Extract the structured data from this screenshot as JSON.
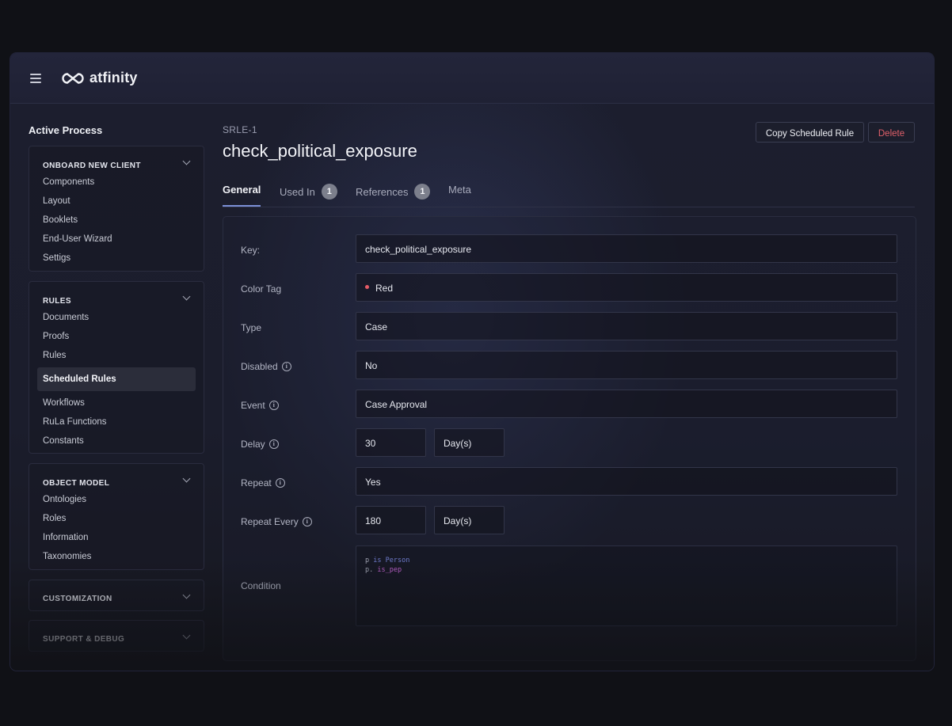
{
  "app": {
    "brand": "atfinity"
  },
  "sidebar": {
    "title": "Active Process",
    "groups": [
      {
        "label": "ONBOARD NEW CLIENT",
        "items": [
          "Components",
          "Layout",
          "Booklets",
          "End-User Wizard",
          "Settigs"
        ]
      },
      {
        "label": "RULES",
        "items": [
          "Documents",
          "Proofs",
          "Rules",
          "Scheduled Rules",
          "Workflows",
          "RuLa Functions",
          "Constants"
        ],
        "active": "Scheduled Rules"
      },
      {
        "label": "OBJECT MODEL",
        "items": [
          "Ontologies",
          "Roles",
          "Information",
          "Taxonomies"
        ]
      },
      {
        "label": "CUSTOMIZATION",
        "items": []
      },
      {
        "label": "SUPPORT & DEBUG",
        "items": []
      }
    ]
  },
  "header": {
    "id": "SRLE-1",
    "title": "check_political_exposure",
    "copy_label": "Copy Scheduled Rule",
    "delete_label": "Delete"
  },
  "tabs": [
    {
      "label": "General",
      "active": true
    },
    {
      "label": "Used In",
      "badge": "1"
    },
    {
      "label": "References",
      "badge": "1"
    },
    {
      "label": "Meta"
    }
  ],
  "form": {
    "key": {
      "label": "Key:",
      "value": "check_political_exposure"
    },
    "color_tag": {
      "label": "Color Tag",
      "value": "Red",
      "color": "#e55b66"
    },
    "type": {
      "label": "Type",
      "value": "Case"
    },
    "disabled": {
      "label": "Disabled",
      "value": "No"
    },
    "event": {
      "label": "Event",
      "value": "Case Approval"
    },
    "delay": {
      "label": "Delay",
      "value": "30",
      "unit": "Day(s)"
    },
    "repeat": {
      "label": "Repeat",
      "value": "Yes"
    },
    "repeat_every": {
      "label": "Repeat Every",
      "value": "180",
      "unit": "Day(s)"
    },
    "condition": {
      "label": "Condition",
      "line1": {
        "var": "p",
        "op": "is Person"
      },
      "line2": {
        "var": "p.",
        "op": "is_pep"
      }
    }
  },
  "colors": {
    "accent": "#7b8fd6",
    "danger": "#e0606a",
    "background": "#1c1e2e"
  },
  "icons": [
    "hamburger-icon",
    "atfinity-logo-icon",
    "chevron-down-icon",
    "info-icon"
  ]
}
